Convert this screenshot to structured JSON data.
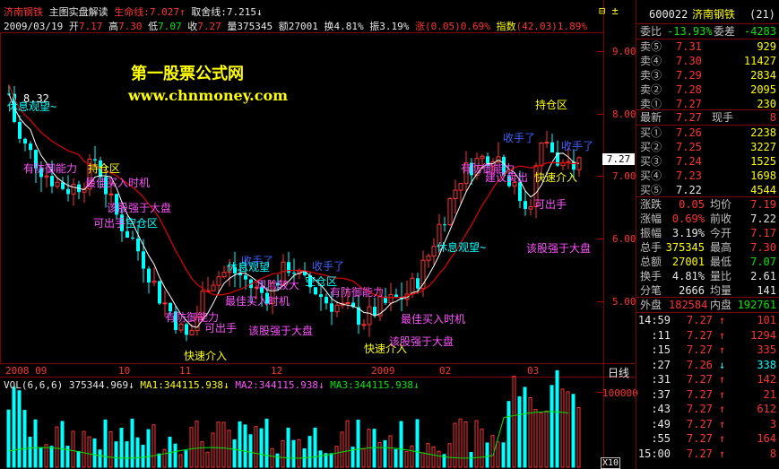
{
  "header": {
    "stock_name": "济南钢铁",
    "indicator_title": "主图实盘解读",
    "lifeline_label": "生命线:",
    "lifeline_value": "7.027",
    "lifeline_arrow": "↑",
    "harmony_label": "取舍线:",
    "harmony_value": "7.215",
    "harmony_arrow": "↓",
    "window_controls": "⊟ ±",
    "date": "2009/03/19",
    "open_label": "开",
    "open_value": "7.17",
    "high_label": "高",
    "high_value": "7.30",
    "low_label": "低",
    "low_value": "7.07",
    "close_label": "收",
    "close_value": "7.27",
    "volume_label": "量",
    "volume_value": "375345",
    "amount_label": "额",
    "amount_value": "27001",
    "turnover_label": "换",
    "turnover_value": "4.81%",
    "amplitude_label": "振",
    "amplitude_value": "3.19%",
    "change_label": "涨",
    "change_value": "(0.05)",
    "change_pct": "0.69%",
    "index_label": "指数",
    "index_value": "(42.03)",
    "index_pct": "1.89%"
  },
  "watermark": {
    "title": "第一股票公式网",
    "url": "www.chnmoney.com"
  },
  "price_axis": {
    "ticks": [
      "9.00",
      "8.00",
      "7.00",
      "6.00",
      "5.00"
    ],
    "current": "7.27"
  },
  "date_axis": {
    "labels": [
      "2008 09",
      "10",
      "11",
      "12",
      "2009",
      "02",
      "03"
    ],
    "period": "日线"
  },
  "volume_panel": {
    "header_prefix": "VOL(6,6,6)",
    "vol_value": "375344.969",
    "vol_arrow": "↓",
    "ma1": "MA1:344115.938",
    "ma1_arrow": "↓",
    "ma2": "MA2:344115.938",
    "ma2_arrow": "↓",
    "ma3": "MA3:344115.938",
    "ma3_arrow": "↓",
    "axis_label": "100000",
    "unit": "X10"
  },
  "annotations": [
    {
      "text": "8.32",
      "color": "#ffffff"
    },
    {
      "text": "休息观望~",
      "color": "#00ffff"
    },
    {
      "text": "有防御能力",
      "color": "#ff50ff"
    },
    {
      "text": "持仓区",
      "color": "#ffff00"
    },
    {
      "text": "最佳买入时机",
      "color": "#ff50ff"
    },
    {
      "text": "该股强于大盘",
      "color": "#ff50ff"
    },
    {
      "text": "可出手",
      "color": "#ff50ff"
    },
    {
      "text": "空仓区",
      "color": "#00ffff"
    },
    {
      "text": "有防御能力",
      "color": "#ff50ff"
    },
    {
      "text": "可出手",
      "color": "#ff50ff"
    },
    {
      "text": "快速介入",
      "color": "#ffff00"
    },
    {
      "text": "收手了",
      "color": "#4060ff"
    },
    {
      "text": "休息观望",
      "color": "#00ffff"
    },
    {
      "text": "风险较大",
      "color": "#ff50ff"
    },
    {
      "text": "最佳买入时机",
      "color": "#ff50ff"
    },
    {
      "text": "该股强于大盘",
      "color": "#ff50ff"
    },
    {
      "text": "收手了",
      "color": "#4060ff"
    },
    {
      "text": "空仓区",
      "color": "#00ffff"
    },
    {
      "text": "有防御能力",
      "color": "#ff50ff"
    },
    {
      "text": "最佳买入时机",
      "color": "#ff50ff"
    },
    {
      "text": "快速介入",
      "color": "#ffff00"
    },
    {
      "text": "该股强于大盘",
      "color": "#ff50ff"
    },
    {
      "text": "休息观望~",
      "color": "#00ffff"
    },
    {
      "text": "有防御能力",
      "color": "#ff50ff"
    },
    {
      "text": "收手了",
      "color": "#4060ff"
    },
    {
      "text": "持仓区",
      "color": "#ffff00"
    },
    {
      "text": "建议卖出",
      "color": "#ff50ff"
    },
    {
      "text": "快速介入",
      "color": "#ffff00"
    },
    {
      "text": "可出手",
      "color": "#ff50ff"
    },
    {
      "text": "收手了",
      "color": "#4060ff"
    },
    {
      "text": "该股强于大盘",
      "color": "#ff50ff"
    }
  ],
  "quote": {
    "code": "600022",
    "name": "济南钢铁",
    "seq": "(21)",
    "webi_label": "委比",
    "webi_value": "-13.93%",
    "weicha_label": "委差",
    "weicha_value": "-4283",
    "sells": [
      {
        "label": "卖⑤",
        "price": "7.31",
        "vol": "929"
      },
      {
        "label": "卖④",
        "price": "7.30",
        "vol": "11427"
      },
      {
        "label": "卖③",
        "price": "7.29",
        "vol": "2834"
      },
      {
        "label": "卖②",
        "price": "7.28",
        "vol": "2095"
      },
      {
        "label": "卖①",
        "price": "7.27",
        "vol": "230"
      }
    ],
    "latest_label": "最新",
    "latest_value": "7.27",
    "xianshou_label": "现手",
    "xianshou_value": "8",
    "buys": [
      {
        "label": "买①",
        "price": "7.26",
        "vol": "2238"
      },
      {
        "label": "买②",
        "price": "7.25",
        "vol": "3227"
      },
      {
        "label": "买③",
        "price": "7.24",
        "vol": "1525"
      },
      {
        "label": "买④",
        "price": "7.23",
        "vol": "1698"
      },
      {
        "label": "买⑤",
        "price": "7.22",
        "vol": "4544"
      }
    ],
    "stats": [
      {
        "l1": "涨跌",
        "v1": "0.05",
        "l2": "均价",
        "v2": "7.19"
      },
      {
        "l1": "涨幅",
        "v1": "0.69%",
        "l2": "前收",
        "v2": "7.22"
      },
      {
        "l1": "振幅",
        "v1": "3.19%",
        "l2": "今开",
        "v2": "7.17"
      },
      {
        "l1": "总手",
        "v1": "375345",
        "l2": "最高",
        "v2": "7.30"
      },
      {
        "l1": "总额",
        "v1": "27001",
        "l2": "最低",
        "v2": "7.07"
      },
      {
        "l1": "换手",
        "v1": "4.81%",
        "l2": "量比",
        "v2": "2.61"
      },
      {
        "l1": "分笔",
        "v1": "2666",
        "l2": "均量",
        "v2": "141"
      }
    ],
    "outer_label": "外盘",
    "outer_value": "182584",
    "inner_label": "内盘",
    "inner_value": "192761",
    "ticks": [
      {
        "time": "14:59",
        "price": "7.27",
        "arrow": "↑",
        "vol": "101"
      },
      {
        "time": ":11",
        "price": "7.27",
        "arrow": "↑",
        "vol": "1294"
      },
      {
        "time": ":15",
        "price": "7.27",
        "arrow": "↑",
        "vol": "335"
      },
      {
        "time": ":27",
        "price": "7.26",
        "arrow": "↓",
        "vol": "338"
      },
      {
        "time": ":31",
        "price": "7.27",
        "arrow": "↑",
        "vol": "142"
      },
      {
        "time": ":37",
        "price": "7.27",
        "arrow": "↑",
        "vol": "21"
      },
      {
        "time": ":43",
        "price": "7.27",
        "arrow": "↑",
        "vol": "612"
      },
      {
        "time": ":49",
        "price": "7.27",
        "arrow": "↑",
        "vol": "3"
      },
      {
        "time": ":55",
        "price": "7.27",
        "arrow": "↑",
        "vol": "164"
      },
      {
        "time": "15:00",
        "price": "7.27",
        "arrow": "↑",
        "vol": "8"
      }
    ]
  }
}
